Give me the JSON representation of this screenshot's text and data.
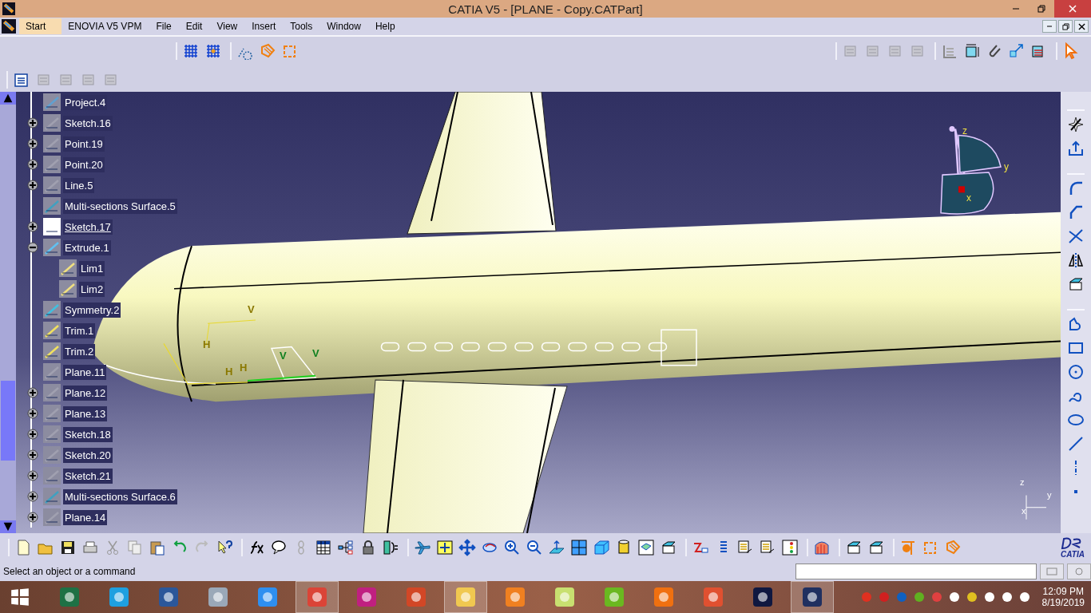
{
  "window": {
    "title": "CATIA V5 - [PLANE - Copy.CATPart]"
  },
  "menu": [
    {
      "label": "Start",
      "selected": true
    },
    {
      "label": "ENOVIA V5 VPM",
      "selected": false
    },
    {
      "label": "File",
      "selected": false
    },
    {
      "label": "Edit",
      "selected": false
    },
    {
      "label": "View",
      "selected": false
    },
    {
      "label": "Insert",
      "selected": false
    },
    {
      "label": "Tools",
      "selected": false
    },
    {
      "label": "Window",
      "selected": false
    },
    {
      "label": "Help",
      "selected": false
    }
  ],
  "tree": [
    {
      "label": "Project.4",
      "kind": "project",
      "active": false
    },
    {
      "label": "Sketch.16",
      "kind": "sketch",
      "expanded": false,
      "active": false
    },
    {
      "label": "Point.19",
      "kind": "point",
      "expanded": false,
      "active": false
    },
    {
      "label": "Point.20",
      "kind": "point",
      "expanded": false,
      "active": false
    },
    {
      "label": "Line.5",
      "kind": "line",
      "expanded": false,
      "active": false
    },
    {
      "label": "Multi-sections Surface.5",
      "kind": "surface",
      "active": false
    },
    {
      "label": "Sketch.17",
      "kind": "sketch-active",
      "expanded": false,
      "active": true
    },
    {
      "label": "Extrude.1",
      "kind": "extrude",
      "expanded": true,
      "active": false,
      "children": [
        {
          "label": "Lim1",
          "kind": "limit",
          "active": false
        },
        {
          "label": "Lim2",
          "kind": "limit",
          "active": false
        }
      ]
    },
    {
      "label": "Symmetry.2",
      "kind": "symmetry",
      "active": false
    },
    {
      "label": "Trim.1",
      "kind": "trim",
      "active": false
    },
    {
      "label": "Trim.2",
      "kind": "trim",
      "active": false
    },
    {
      "label": "Plane.11",
      "kind": "plane",
      "active": false
    },
    {
      "label": "Plane.12",
      "kind": "plane",
      "expanded": false,
      "active": false
    },
    {
      "label": "Plane.13",
      "kind": "plane",
      "expanded": false,
      "active": false
    },
    {
      "label": "Sketch.18",
      "kind": "sketch",
      "expanded": false,
      "active": false
    },
    {
      "label": "Sketch.20",
      "kind": "sketch",
      "expanded": false,
      "active": false
    },
    {
      "label": "Sketch.21",
      "kind": "sketch",
      "expanded": false,
      "active": false
    },
    {
      "label": "Multi-sections Surface.6",
      "kind": "surface",
      "expanded": false,
      "active": false
    },
    {
      "label": "Plane.14",
      "kind": "plane",
      "expanded": false,
      "active": false
    }
  ],
  "sketch_labels": [
    {
      "text": "V",
      "color": "#8a7800"
    },
    {
      "text": "H",
      "color": "#8a7800"
    },
    {
      "text": "H",
      "color": "#8a7800"
    },
    {
      "text": "H",
      "color": "#8a7800"
    },
    {
      "text": "V",
      "color": "#108020"
    },
    {
      "text": "V",
      "color": "#108020"
    }
  ],
  "compass": {
    "axes": [
      "z",
      "y",
      "x"
    ]
  },
  "axis_triad": {
    "axes": [
      "z",
      "y",
      "x"
    ]
  },
  "logo": "CATIA",
  "status_bar": {
    "message": "Select an object or a command"
  },
  "taskbar": {
    "apps": [
      {
        "selected": false
      },
      {
        "selected": false
      },
      {
        "selected": false
      },
      {
        "selected": false
      },
      {
        "selected": false
      },
      {
        "selected": true
      },
      {
        "selected": false
      },
      {
        "selected": false
      },
      {
        "selected": true
      },
      {
        "selected": false
      },
      {
        "selected": false
      },
      {
        "selected": false
      },
      {
        "selected": false
      },
      {
        "selected": false
      },
      {
        "selected": false
      },
      {
        "selected": true
      }
    ],
    "time": "12:09 PM",
    "date": "8/19/2019"
  }
}
